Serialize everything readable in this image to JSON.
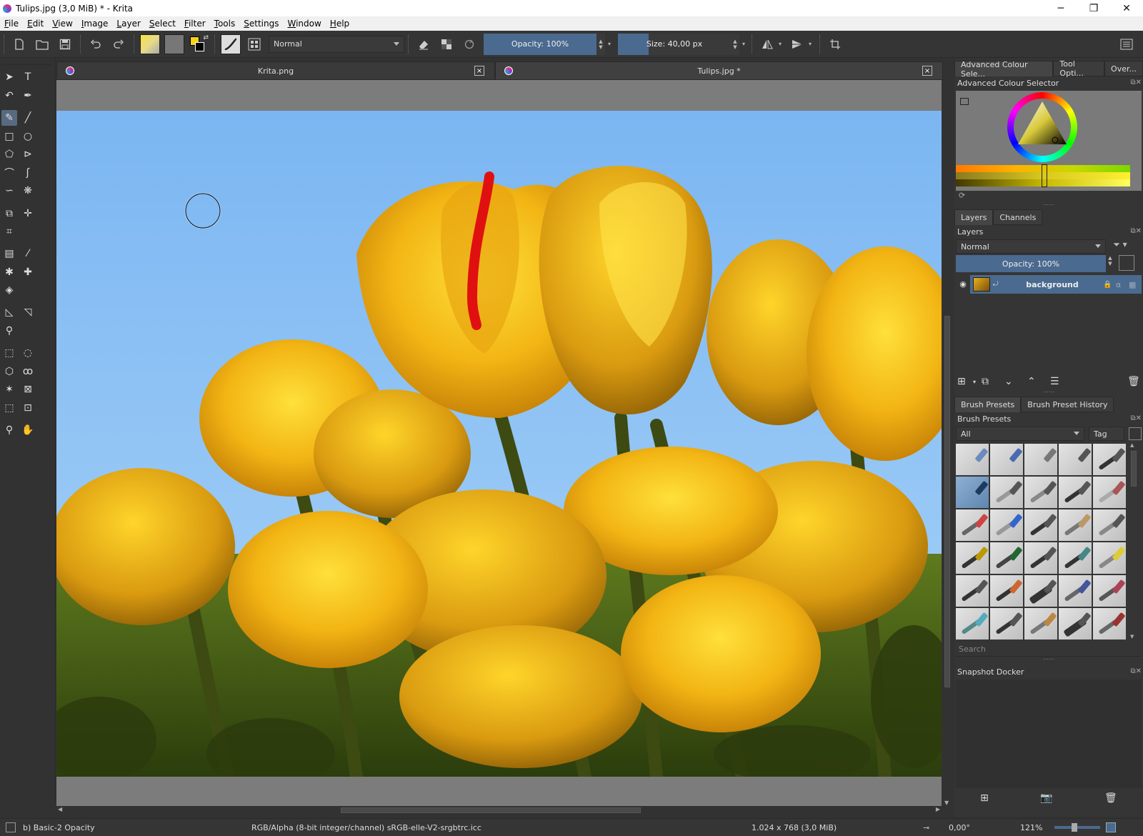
{
  "window": {
    "title": "Tulips.jpg (3,0 MiB)  * - Krita",
    "minimize": "─",
    "restore": "❐",
    "close": "✕"
  },
  "menu": [
    "File",
    "Edit",
    "View",
    "Image",
    "Layer",
    "Select",
    "Filter",
    "Tools",
    "Settings",
    "Window",
    "Help"
  ],
  "toolbar": {
    "blend_mode": "Normal",
    "opacity": "Opacity: 100%",
    "opacity_value": 1.0,
    "size": "Size: 40,00 px",
    "size_fraction": 0.27,
    "fg_color": "#f7d21b",
    "bg_color": "#000000"
  },
  "tabs": [
    {
      "label": "Krita.png",
      "close": "×"
    },
    {
      "label": "Tulips.jpg *",
      "close": "×"
    }
  ],
  "dock": {
    "top_tabs": [
      "Advanced Colour Sele...",
      "Tool Opti...",
      "Over..."
    ],
    "colour_selector_title": "Advanced Colour Selector",
    "layers_tabs": [
      "Layers",
      "Channels"
    ],
    "layers_title": "Layers",
    "layers_blend": "Normal",
    "layers_opacity": "Opacity:  100%",
    "layer_name": "background",
    "presets_tabs": [
      "Brush Presets",
      "Brush Preset History"
    ],
    "presets_title": "Brush Presets",
    "presets_filter": "All",
    "presets_tag": "Tag",
    "presets_search": "Search",
    "snapshot_title": "Snapshot Docker"
  },
  "status": {
    "brush": "b) Basic-2 Opacity",
    "colorspace": "RGB/Alpha (8-bit integer/channel)  sRGB-elle-V2-srgbtrc.icc",
    "dimensions": "1.024 x 768 (3,0 MiB)",
    "rotation": "0,00°",
    "zoom": "121%"
  }
}
